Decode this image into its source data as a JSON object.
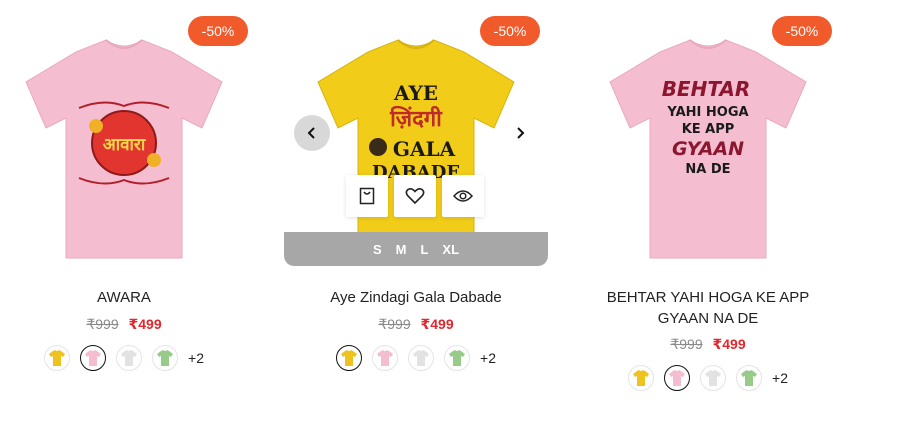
{
  "products": [
    {
      "name": "AWARA",
      "discount": "-50%",
      "old_price": "₹999",
      "new_price": "₹499",
      "shirt_color": "#f5bed0",
      "print_text": "आवारा",
      "swatches": [
        {
          "name": "yellow",
          "color": "#eec21f",
          "active": false
        },
        {
          "name": "pink",
          "color": "#f5bed0",
          "active": true
        },
        {
          "name": "white",
          "color": "#ececec",
          "active": false
        },
        {
          "name": "green",
          "color": "#98cb8a",
          "active": false
        }
      ],
      "more_colors": "+2"
    },
    {
      "name": "Aye Zindagi Gala Dabade",
      "discount": "-50%",
      "old_price": "₹999",
      "new_price": "₹499",
      "shirt_color": "#f1cc19",
      "print_lines": [
        "AYE",
        "ज़िंदगी",
        "GALA",
        "DABADE"
      ],
      "sizes": [
        "S",
        "M",
        "L",
        "XL"
      ],
      "swatches": [
        {
          "name": "yellow",
          "color": "#eec21f",
          "active": true
        },
        {
          "name": "pink",
          "color": "#f5bed0",
          "active": false
        },
        {
          "name": "white",
          "color": "#ececec",
          "active": false
        },
        {
          "name": "green",
          "color": "#98cb8a",
          "active": false
        }
      ],
      "more_colors": "+2"
    },
    {
      "name": "BEHTAR YAHI HOGA KE APP GYAAN NA DE",
      "discount": "-50%",
      "old_price": "₹999",
      "new_price": "₹499",
      "shirt_color": "#f5bed0",
      "print_lines": [
        "BEHTAR",
        "YAHI HOGA",
        "KE APP",
        "GYAAN",
        "NA DE"
      ],
      "swatches": [
        {
          "name": "yellow",
          "color": "#eec21f",
          "active": false
        },
        {
          "name": "pink",
          "color": "#f5bed0",
          "active": true
        },
        {
          "name": "white",
          "color": "#ececec",
          "active": false
        },
        {
          "name": "green",
          "color": "#98cb8a",
          "active": false
        }
      ],
      "more_colors": "+2"
    }
  ],
  "icons": {
    "prev": "chevron-left-icon",
    "next": "chevron-right-icon",
    "cart": "shopping-bag-icon",
    "wishlist": "heart-icon",
    "quick_view": "eye-icon"
  },
  "colors": {
    "badge": "#f15a2b",
    "sale_price": "#e0282e",
    "size_bar": "#a7a7a7"
  }
}
